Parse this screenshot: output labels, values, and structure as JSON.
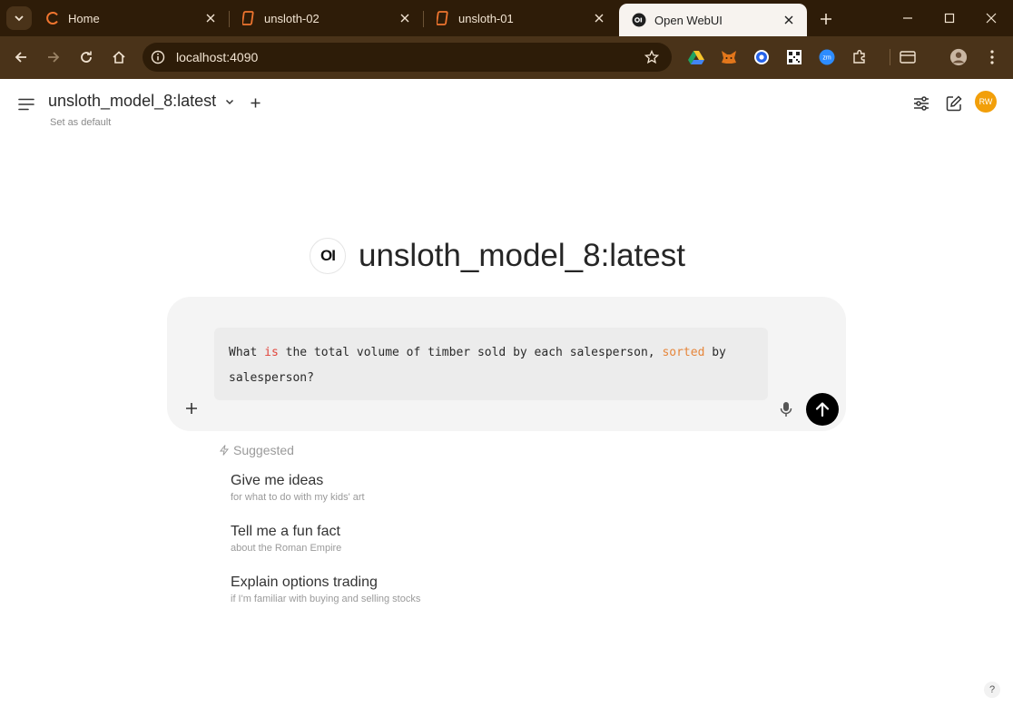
{
  "browser": {
    "tabs": [
      {
        "title": "Home",
        "active": false
      },
      {
        "title": "unsloth-02",
        "active": false
      },
      {
        "title": "unsloth-01",
        "active": false
      },
      {
        "title": "Open WebUI",
        "active": true
      }
    ],
    "url": "localhost:4090",
    "accent": "#2e1c08",
    "toolbar_color": "#4a3319"
  },
  "header": {
    "model_name": "unsloth_model_8:latest",
    "set_default": "Set as default",
    "avatar_initials": "RW",
    "avatar_color": "#f29f0a"
  },
  "hero": {
    "logo_text": "OI",
    "title": "unsloth_model_8:latest"
  },
  "prompt": {
    "part1": "What ",
    "kw1": "is",
    "part2": " the total volume of timber sold by each salesperson, ",
    "kw2": "sorted",
    "part3": " by",
    "line2": "salesperson?"
  },
  "suggested": {
    "label": "Suggested",
    "items": [
      {
        "title": "Give me ideas",
        "subtitle": "for what to do with my kids' art"
      },
      {
        "title": "Tell me a fun fact",
        "subtitle": "about the Roman Empire"
      },
      {
        "title": "Explain options trading",
        "subtitle": "if I'm familiar with buying and selling stocks"
      }
    ]
  },
  "help_label": "?"
}
